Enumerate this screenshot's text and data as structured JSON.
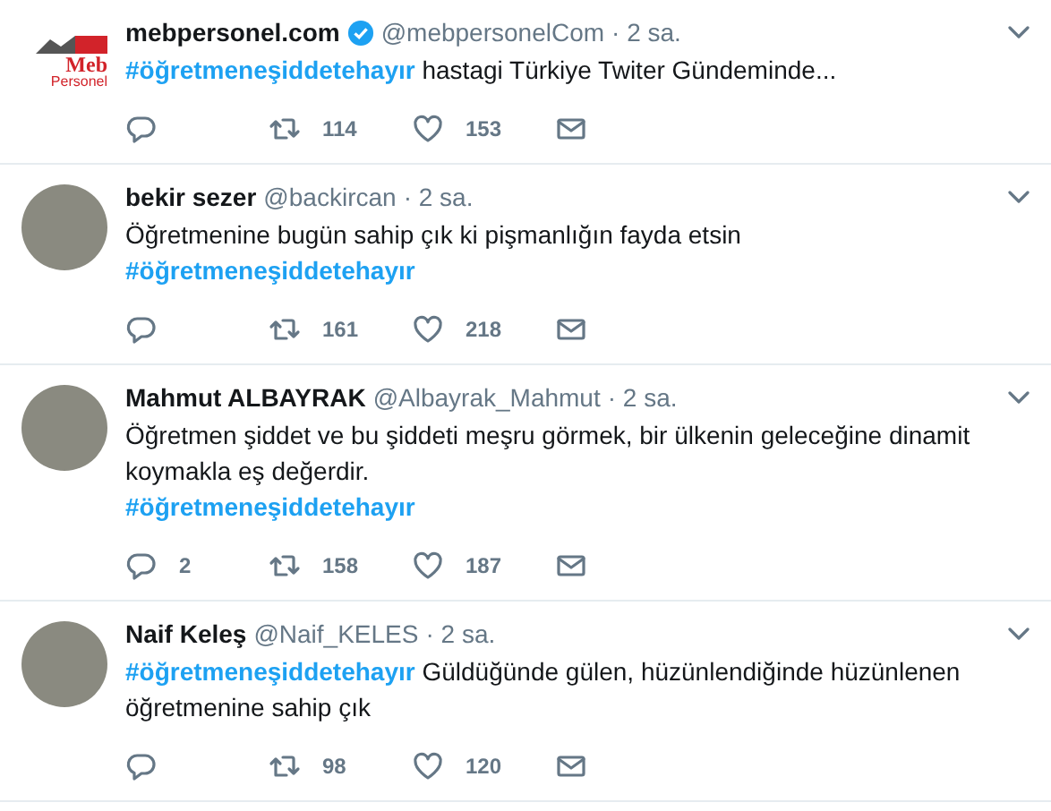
{
  "tweets": [
    {
      "name": "mebpersonel.com",
      "verified": true,
      "handle": "@mebpersonelCom",
      "time": "· 2 sa.",
      "avatar": {
        "kind": "logo",
        "logo_text": [
          "Meb",
          "Personel"
        ]
      },
      "body": [
        {
          "kind": "hashtag",
          "text": "#öğretmeneşiddetehayır"
        },
        {
          "kind": "text",
          "text": " hastagi Türkiye Twiter Gündeminde..."
        }
      ],
      "retweets": "114",
      "likes": "153"
    },
    {
      "name": "bekir sezer",
      "verified": false,
      "handle": "@backircan",
      "time": "· 2 sa.",
      "avatar": {
        "kind": "photo"
      },
      "body": [
        {
          "kind": "text",
          "text": "Öğretmenine bugün sahip çık ki pişmanlığın fayda etsin"
        },
        {
          "kind": "break"
        },
        {
          "kind": "hashtag",
          "text": "#öğretmeneşiddetehayır"
        }
      ],
      "retweets": "161",
      "likes": "218"
    },
    {
      "name": "Mahmut ALBAYRAK",
      "verified": false,
      "handle": "@Albayrak_Mahmut",
      "time": "· 2 sa.",
      "avatar": {
        "kind": "photo"
      },
      "body": [
        {
          "kind": "text",
          "text": "Öğretmen şiddet ve bu şiddeti meşru görmek, bir ülkenin geleceğine dinamit koymakla eş değerdir."
        },
        {
          "kind": "break"
        },
        {
          "kind": "hashtag",
          "text": "#öğretmeneşiddetehayır"
        }
      ],
      "replies": "2",
      "retweets": "158",
      "likes": "187"
    },
    {
      "name": "Naif Keleş",
      "verified": false,
      "handle": "@Naif_KELES",
      "time": "· 2 sa.",
      "avatar": {
        "kind": "photo"
      },
      "body": [
        {
          "kind": "hashtag",
          "text": "#öğretmeneşiddetehayır"
        },
        {
          "kind": "text",
          "text": " Güldüğünde gülen, hüzünlendiğinde hüzünlenen öğretmenine sahip çık"
        }
      ],
      "retweets": "98",
      "likes": "120"
    }
  ]
}
